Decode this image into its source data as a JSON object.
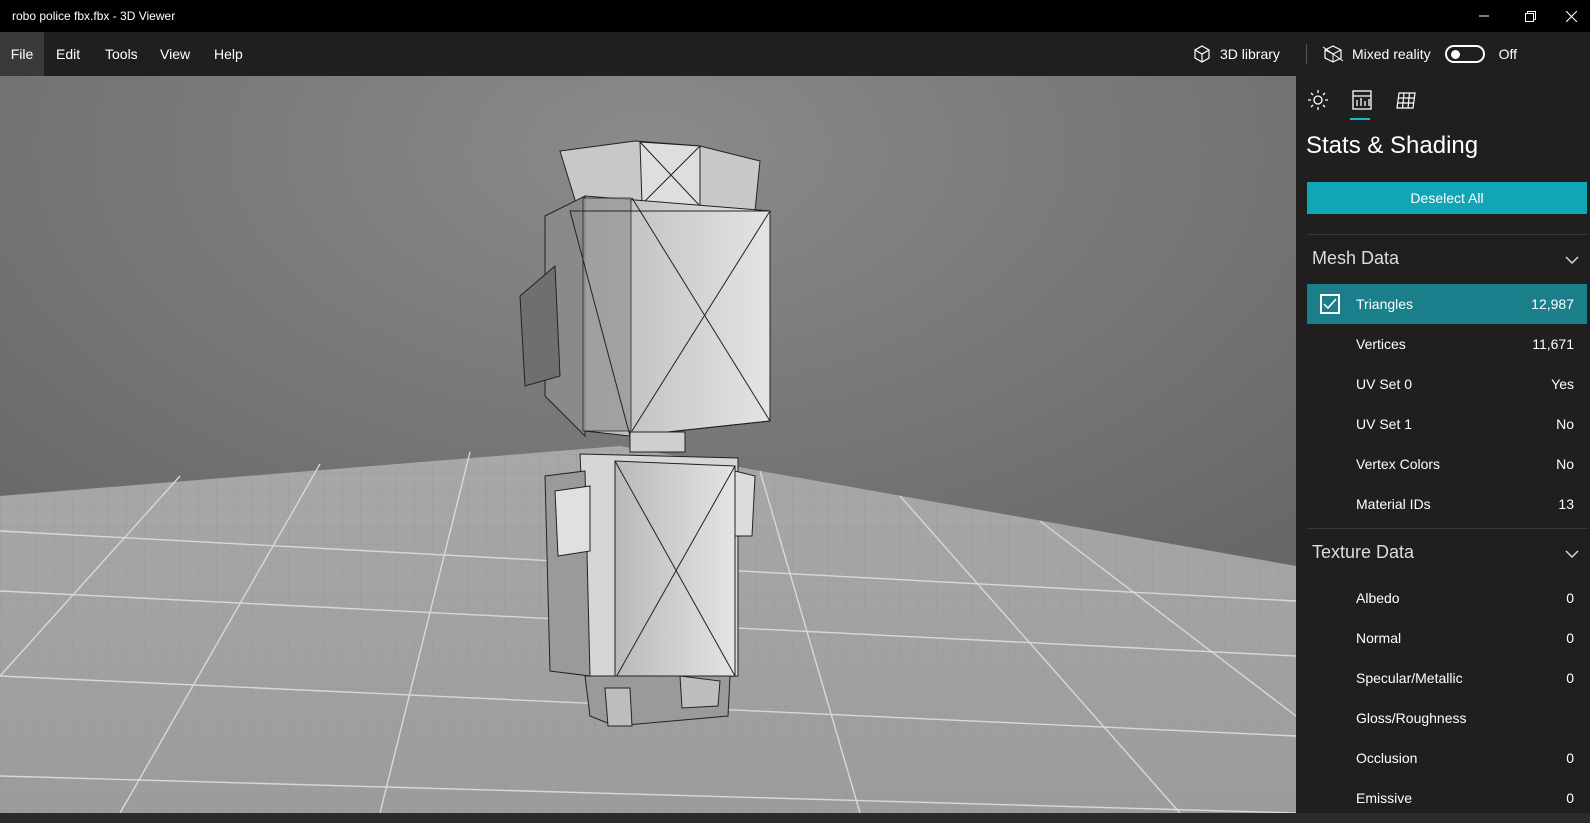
{
  "window": {
    "title": "robo police fbx.fbx - 3D Viewer"
  },
  "menu": {
    "items": [
      "File",
      "Edit",
      "Tools",
      "View",
      "Help"
    ],
    "active": "File"
  },
  "toolbar": {
    "library_label": "3D library",
    "mixed_reality_label": "Mixed reality",
    "mixed_reality_state": "Off"
  },
  "panel": {
    "tabs": [
      "lighting-icon",
      "stats-icon",
      "grid-icon"
    ],
    "title": "Stats & Shading",
    "deselect_label": "Deselect All",
    "mesh": {
      "header": "Mesh Data",
      "rows": [
        {
          "label": "Triangles",
          "value": "12,987",
          "checked": true
        },
        {
          "label": "Vertices",
          "value": "11,671"
        },
        {
          "label": "UV Set 0",
          "value": "Yes"
        },
        {
          "label": "UV Set 1",
          "value": "No"
        },
        {
          "label": "Vertex Colors",
          "value": "No"
        },
        {
          "label": "Material IDs",
          "value": "13"
        }
      ]
    },
    "texture": {
      "header": "Texture Data",
      "rows": [
        {
          "label": "Albedo",
          "value": "0"
        },
        {
          "label": "Normal",
          "value": "0"
        },
        {
          "label": "Specular/Metallic",
          "value": "0"
        },
        {
          "label": "Gloss/Roughness",
          "value": ""
        },
        {
          "label": "Occlusion",
          "value": "0"
        },
        {
          "label": "Emissive",
          "value": "0"
        }
      ]
    }
  },
  "colors": {
    "accent": "#12a5b5",
    "selected_row": "#1a7f8a",
    "panel_bg": "#1f1f1f"
  }
}
